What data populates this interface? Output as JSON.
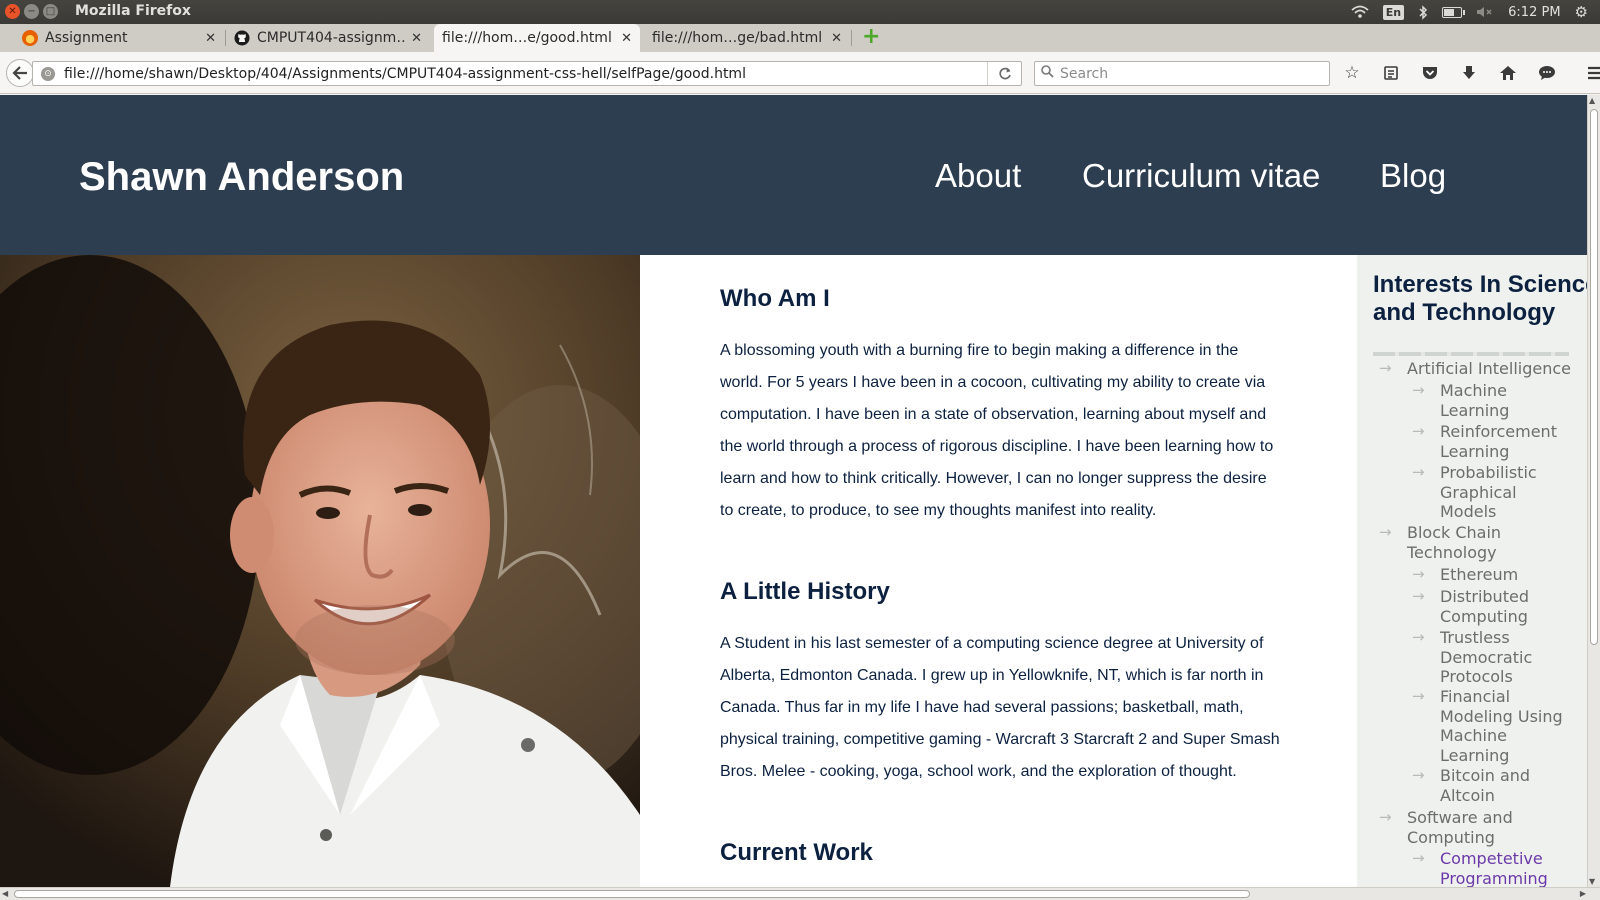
{
  "os": {
    "window_title": "Mozilla Firefox",
    "language": "En",
    "clock": "6:12 PM"
  },
  "tabs": [
    {
      "label": "Assignment",
      "icon": "firefox-icon",
      "active": false
    },
    {
      "label": "CMPUT404-assignm…",
      "icon": "github-icon",
      "active": false
    },
    {
      "label": "file:///hom…e/good.html",
      "icon": "",
      "active": true
    },
    {
      "label": "file:///hom…ge/bad.html",
      "icon": "",
      "active": false
    }
  ],
  "toolbar": {
    "url": "file:///home/shawn/Desktop/404/Assignments/CMPUT404-assignment-css-hell/selfPage/good.html",
    "search_placeholder": "Search",
    "icons": [
      "bookmark-star-icon",
      "reading-list-icon",
      "pocket-icon",
      "download-icon",
      "home-icon",
      "chat-icon",
      "hamburger-menu-icon"
    ]
  },
  "page": {
    "site_name": "Shawn Anderson",
    "nav": [
      "About",
      "Curriculum vitae",
      "Blog"
    ],
    "sections": [
      {
        "title": "Who Am I",
        "body": "A blossoming youth with a burning fire to begin making a difference in the world. For 5 years I have been in a cocoon, cultivating my ability to create via computation. I have been in a state of observation, learning about myself and the world through a process of rigorous discipline. I have been learning how to learn and how to think critically. However, I can no longer suppress the desire to create, to produce, to see my thoughts manifest into reality."
      },
      {
        "title": "A Little History",
        "body": "A Student in his last semester of a computing science degree at University of Alberta, Edmonton Canada. I grew up in Yellowknife, NT, which is far north in Canada. Thus far in my life I have had several passions; basketball, math, physical training, competitive gaming - Warcraft 3 Starcraft 2 and Super Smash Bros. Melee - cooking, yoga, school work, and the exploration of thought."
      },
      {
        "title": "Current Work",
        "body": ""
      }
    ],
    "sidebar": {
      "title": "Interests In Science and Technology",
      "items": [
        {
          "label": "Artificial Intelligence",
          "level": 1
        },
        {
          "label": "Machine Learning",
          "level": 2
        },
        {
          "label": "Reinforcement Learning",
          "level": 2
        },
        {
          "label": "Probabilistic Graphical Models",
          "level": 2
        },
        {
          "label": "Block Chain Technology",
          "level": 1
        },
        {
          "label": "Ethereum",
          "level": 2
        },
        {
          "label": "Distributed Computing",
          "level": 2
        },
        {
          "label": "Trustless Democratic Protocols",
          "level": 2
        },
        {
          "label": "Financial Modeling Using Machine Learning",
          "level": 2
        },
        {
          "label": "Bitcoin and Altcoin",
          "level": 2
        },
        {
          "label": "Software and Computing",
          "level": 1
        },
        {
          "label": "Competetive Programming",
          "level": 2,
          "visited": true
        }
      ]
    }
  }
}
